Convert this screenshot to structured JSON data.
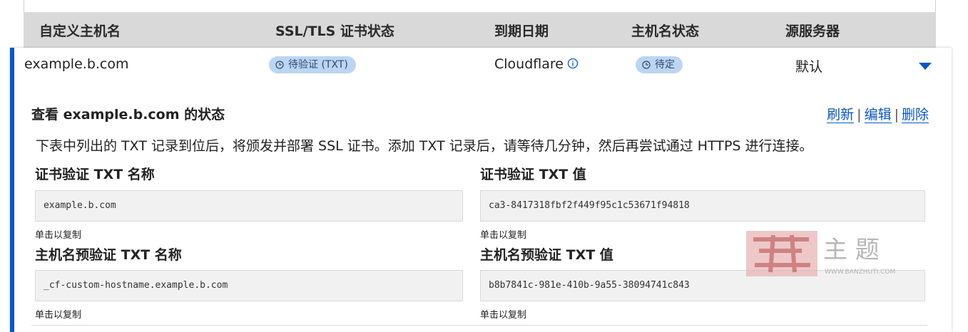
{
  "table": {
    "headers": [
      "自定义主机名",
      "SSL/TLS 证书状态",
      "到期日期",
      "主机名状态",
      "源服务器"
    ]
  },
  "row": {
    "hostname": "example.b.com",
    "ssl_status": "待验证 (TXT)",
    "expiry": "Cloudflare",
    "hostname_status": "待定",
    "origin": "默认"
  },
  "details": {
    "title": "查看 example.b.com 的状态",
    "actions": {
      "refresh": "刷新",
      "edit": "编辑",
      "delete": "删除",
      "separator": "|"
    },
    "description": "下表中列出的 TXT 记录到位后，将颁发并部署 SSL 证书。添加 TXT 记录后，请等待几分钟，然后再尝试通过 HTTPS 进行连接。",
    "cert_name_label": "证书验证 TXT 名称",
    "cert_name_value": "example.b.com",
    "cert_value_label": "证书验证 TXT 值",
    "cert_value_value": "ca3-8417318fbf2f449f95c1c53671f94818",
    "pre_name_label": "主机名预验证 TXT 名称",
    "pre_name_value": "_cf-custom-hostname.example.b.com",
    "pre_value_label": "主机名预验证 TXT 值",
    "pre_value_value": "b8b7841c-981e-410b-9a55-38094741c843",
    "copy_hint": "单击以复制"
  },
  "watermark": {
    "text": "主 题",
    "url": "WWW.BANZHUTI.COM"
  },
  "icons": {
    "clock": "clock-icon",
    "info": "info-icon",
    "expand": "caret-down-icon"
  },
  "colors": {
    "accent": "#0a57c2",
    "badge_bg": "#bcd5f1",
    "header_bg": "#d9d9d9"
  }
}
